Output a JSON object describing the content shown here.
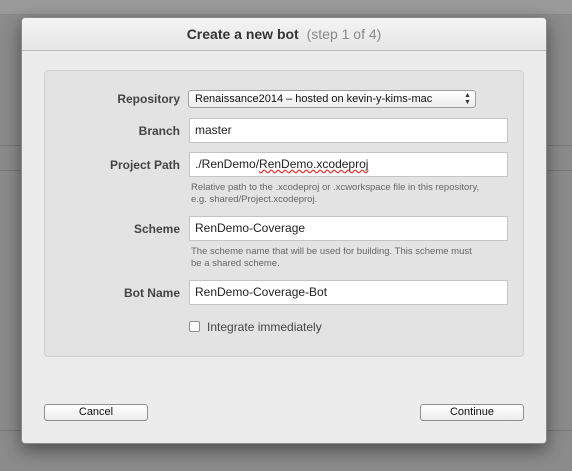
{
  "dialog": {
    "title": "Create a new bot",
    "step": "(step 1 of 4)"
  },
  "form": {
    "repository": {
      "label": "Repository",
      "value": "Renaissance2014 – hosted on kevin-y-kims-mac"
    },
    "branch": {
      "label": "Branch",
      "value": "master"
    },
    "project_path": {
      "label": "Project Path",
      "value_prefix": "./RenDemo/",
      "value_misspelled": "RenDemo.xcodeproj",
      "help": "Relative path to the .xcodeproj or .xcworkspace file in this repository, e.g. shared/Project.xcodeproj."
    },
    "scheme": {
      "label": "Scheme",
      "value": "RenDemo-Coverage",
      "help": "The scheme name that will be used for building. This scheme must be a shared scheme."
    },
    "bot_name": {
      "label": "Bot Name",
      "value": "RenDemo-Coverage-Bot"
    },
    "integrate": {
      "label": "Integrate immediately",
      "checked": false
    }
  },
  "buttons": {
    "cancel": "Cancel",
    "continue": "Continue"
  },
  "icons": {
    "popup_arrows": "up-down-chevron-icon"
  }
}
